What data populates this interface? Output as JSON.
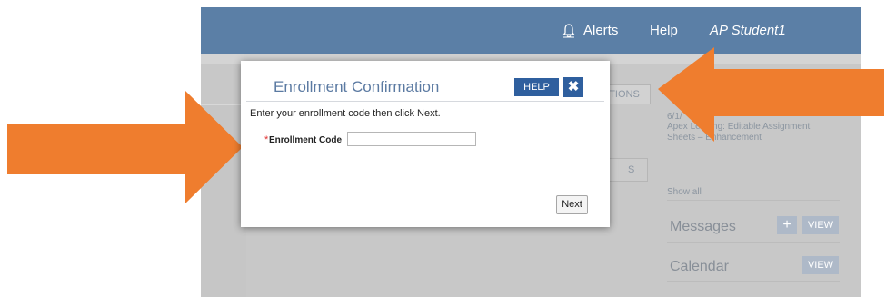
{
  "header": {
    "alerts_label": "Alerts",
    "help_label": "Help",
    "user_name": "AP Student1"
  },
  "background": {
    "options_button_partial": "TIONS",
    "announcement_date": "6/1/",
    "announcement_text": "Apex Le    ing: Editable Assignment Sheets – Enhancement",
    "show_all": "Show all",
    "messages_title": "Messages",
    "calendar_title": "Calendar",
    "view_label": "VIEW",
    "plus_label": "+",
    "mid_box_text": "S"
  },
  "modal": {
    "title": "Enrollment Confirmation",
    "help_button": "HELP",
    "close_button": "✖",
    "instruction": "Enter your enrollment code then click Next.",
    "required_marker": "*",
    "code_label": "Enrollment Code",
    "code_value": "",
    "next_button": "Next"
  },
  "colors": {
    "header_bg": "#5b7fa6",
    "modal_accent": "#2f5f9e",
    "arrow": "#ef7d2e",
    "overlay": "#c8c8c8"
  },
  "icons": {
    "bell": "bell-icon",
    "close": "close-icon",
    "plus": "plus-icon"
  }
}
